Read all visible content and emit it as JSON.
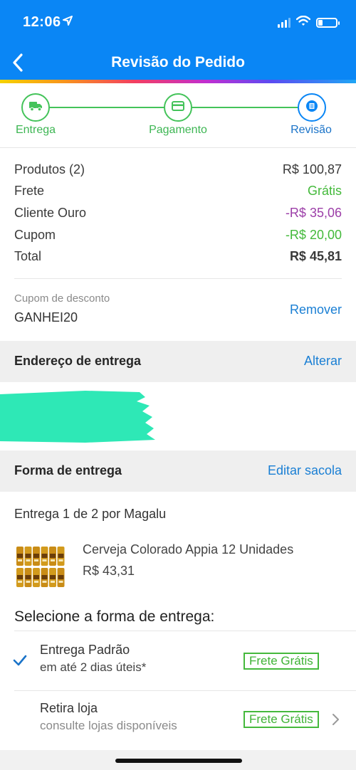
{
  "status_bar": {
    "time": "12:06",
    "location_arrow": "location-arrow-icon",
    "signal": "signal-icon",
    "wifi": "wifi-icon",
    "battery": "battery-icon"
  },
  "header": {
    "title": "Revisão do Pedido",
    "back_icon": "back-chevron-icon"
  },
  "steps": [
    {
      "label": "Entrega",
      "icon": "truck-icon",
      "state": "done"
    },
    {
      "label": "Pagamento",
      "icon": "card-icon",
      "state": "done"
    },
    {
      "label": "Revisão",
      "icon": "receipt-icon",
      "state": "current"
    }
  ],
  "summary": [
    {
      "label": "Produtos (2)",
      "value": "R$ 100,87",
      "color": "#3a3a3a"
    },
    {
      "label": "Frete",
      "value": "Grátis",
      "color": "#43b93a"
    },
    {
      "label": "Cliente Ouro",
      "value": "-R$ 35,06",
      "color": "#9c3ea8"
    },
    {
      "label": "Cupom",
      "value": "-R$ 20,00",
      "color": "#43b93a"
    },
    {
      "label": "Total",
      "value": "R$ 45,81",
      "color": "#3a3a3a"
    }
  ],
  "coupon": {
    "label": "Cupom de desconto",
    "code": "GANHEI20",
    "remove": "Remover"
  },
  "address": {
    "title": "Endereço de entrega",
    "action": "Alterar"
  },
  "shipping": {
    "title": "Forma de entrega",
    "action": "Editar sacola"
  },
  "delivery": {
    "heading": "Entrega 1 de 2 por Magalu",
    "product_name": "Cerveja Colorado Appia 12 Unidades",
    "product_price": "R$ 43,31"
  },
  "select": {
    "title": "Selecione a forma de entrega:",
    "options": [
      {
        "title": "Entrega Padrão",
        "subtitle": "em até 2 dias úteis*",
        "badge": "Frete Grátis",
        "selected": true
      },
      {
        "title": "Retira loja",
        "subtitle": "consulte lojas disponíveis",
        "badge": "Frete Grátis",
        "selected": false
      }
    ]
  },
  "colors": {
    "primary": "#0a86f5",
    "success": "#43b93a",
    "link": "#1a7fd4",
    "cliente_ouro": "#9c3ea8",
    "redaction": "#2ee8b6"
  }
}
